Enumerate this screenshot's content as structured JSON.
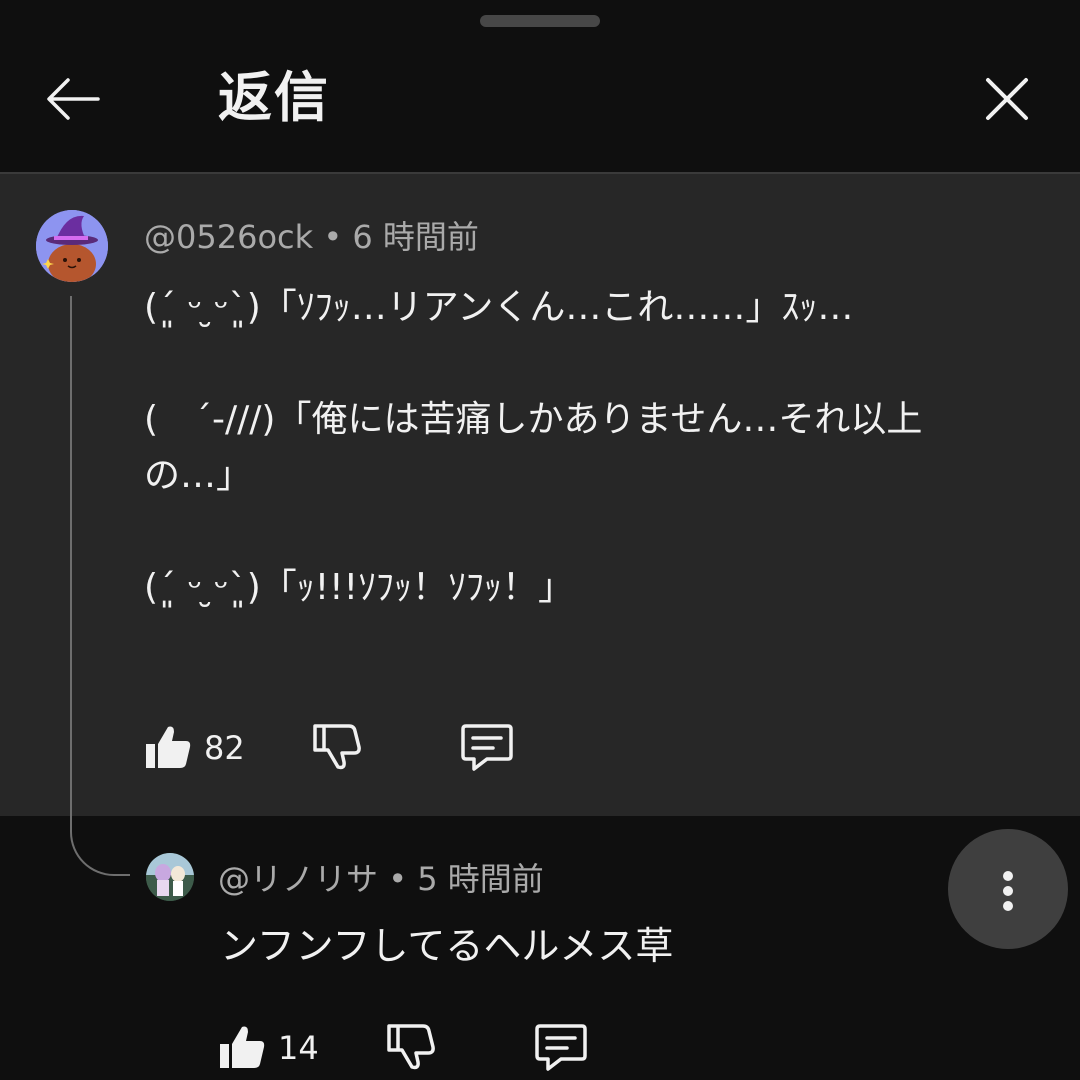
{
  "header": {
    "title": "返信",
    "back_icon": "arrow-left-icon",
    "close_icon": "close-icon"
  },
  "parent_comment": {
    "author": "@0526ock",
    "time": "6 時間前",
    "text": "(´͈ ᵕ ̮ᵕ`͈)「ｿﾌｯ…リアンくん…これ……」ｽｯ…\n\n(　´-///)「俺には苦痛しかありません…それ以上の…」\n\n(´͈ ᵕ ̮ᵕ`͈)「ｯ!!!ｿﾌｯ！ｿﾌｯ！」",
    "likes": "82"
  },
  "reply": {
    "author": "@リノリサ",
    "time": "5 時間前",
    "text": "ンフンフしてるヘルメス草",
    "likes": "14"
  },
  "separator": "•",
  "colors": {
    "background": "#0f0f0f",
    "highlight": "#272727",
    "text": "#f1f1f1",
    "meta": "#aaaaaa",
    "avatar1": "#8d94f0",
    "avatar2": "#3d5b4a"
  }
}
